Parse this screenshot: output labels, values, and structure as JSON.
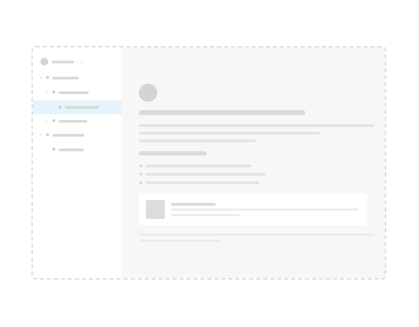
{
  "colors": {
    "selected_row": "#e3f4fb",
    "main_background": "#f8f7f5",
    "placeholder": "#dadada"
  },
  "sidebar": {
    "workspace_switcher": {
      "has_avatar": true,
      "has_chevron": true
    },
    "tree": [
      {
        "id": "item-1",
        "depth": 0,
        "expanded": true,
        "selected": false
      },
      {
        "id": "item-1-1",
        "depth": 1,
        "expanded": true,
        "selected": false
      },
      {
        "id": "item-1-1-1",
        "depth": 2,
        "expanded": false,
        "selected": true
      },
      {
        "id": "item-1-2",
        "depth": 1,
        "expanded": false,
        "selected": false
      },
      {
        "id": "item-2",
        "depth": 0,
        "expanded": false,
        "selected": false
      },
      {
        "id": "item-2-1",
        "depth": 1,
        "expanded": false,
        "selected": false
      }
    ]
  },
  "page": {
    "has_page_icon": true,
    "paragraph_lines": 3,
    "bullet_items": 3,
    "has_link_card": true,
    "footer_lines": 2
  }
}
